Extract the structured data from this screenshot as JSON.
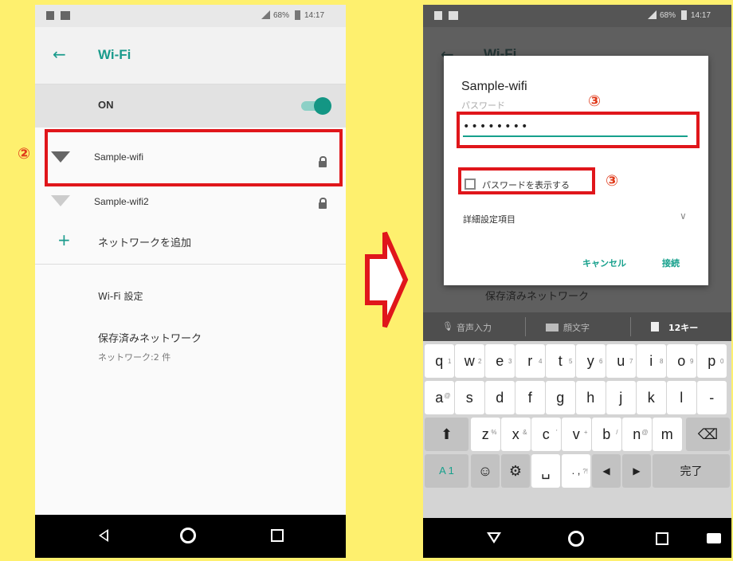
{
  "left": {
    "status": {
      "battery": "68%",
      "time": "14:17"
    },
    "title": "Wi-Fi",
    "toggle_label": "ON",
    "networks": [
      {
        "name": "Sample-wifi"
      },
      {
        "name": "Sample-wifi2"
      }
    ],
    "add_network": "ネットワークを追加",
    "wifi_settings": "Wi-Fi 設定",
    "saved_networks": "保存済みネットワーク",
    "saved_count": "ネットワーク:2 件"
  },
  "annotations": {
    "step2": "②",
    "step3a": "③",
    "step3b": "③"
  },
  "right": {
    "status": {
      "battery": "68%",
      "time": "14:17"
    },
    "bg_title": "Wi-Fi",
    "bg_saved": "保存済みネットワーク",
    "dialog": {
      "title": "Sample-wifi",
      "password_label": "パスワード",
      "password_value": "••••••••",
      "show_password": "パスワードを表示する",
      "advanced": "詳細設定項目",
      "cancel": "キャンセル",
      "connect": "接続"
    },
    "suggest": {
      "voice": "音声入力",
      "template": "顔文字",
      "keys12": "12キー"
    },
    "keyboard": {
      "row1": [
        {
          "k": "q",
          "s": "1"
        },
        {
          "k": "w",
          "s": "2"
        },
        {
          "k": "e",
          "s": "3"
        },
        {
          "k": "r",
          "s": "4"
        },
        {
          "k": "t",
          "s": "5"
        },
        {
          "k": "y",
          "s": "6"
        },
        {
          "k": "u",
          "s": "7"
        },
        {
          "k": "i",
          "s": "8"
        },
        {
          "k": "o",
          "s": "9"
        },
        {
          "k": "p",
          "s": "0"
        }
      ],
      "row2": [
        {
          "k": "a",
          "b": "@"
        },
        {
          "k": "s",
          "b": ""
        },
        {
          "k": "d",
          "b": ""
        },
        {
          "k": "f",
          "b": ""
        },
        {
          "k": "g",
          "b": ""
        },
        {
          "k": "h",
          "b": ""
        },
        {
          "k": "j",
          "b": ""
        },
        {
          "k": "k",
          "b": ""
        },
        {
          "k": "l",
          "b": ""
        },
        {
          "k": "-",
          "b": ""
        }
      ],
      "row3": [
        {
          "k": "z",
          "b": "%"
        },
        {
          "k": "x",
          "b": "&"
        },
        {
          "k": "c",
          "b": "'"
        },
        {
          "k": "v",
          "b": "+"
        },
        {
          "k": "b",
          "b": "/"
        },
        {
          "k": "n",
          "b": "@"
        },
        {
          "k": "m",
          "b": ""
        }
      ],
      "mode_key": "A 1",
      "punct_key": ". ,",
      "punct_sup": "?!",
      "done_key": "完了"
    }
  }
}
